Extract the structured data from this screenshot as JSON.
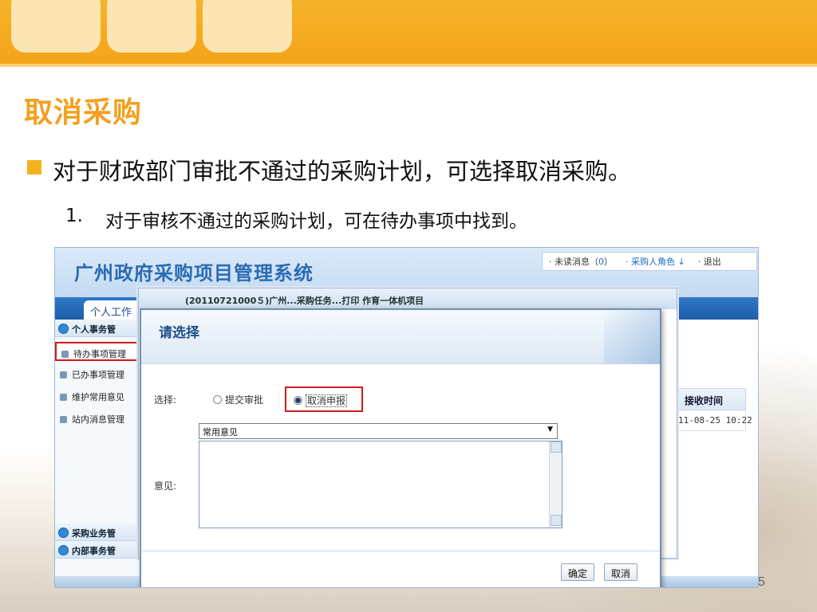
{
  "slide": {
    "title": "取消采购",
    "bullet": "对于财政部门审批不通过的采购计划，可选择取消采购。",
    "sub_number": "1.",
    "sub_text": "对于审核不通过的采购计划，可在待办事项中找到。",
    "page_number": "5",
    "accent_color": "#f3a01f"
  },
  "app": {
    "title": "广州政府采购项目管理系统",
    "top_links": {
      "unread_prefix": "· 未读消息（",
      "unread_count": "0",
      "unread_suffix": "）",
      "role": "· 采购人角色 ↓",
      "logout": "· 退出"
    },
    "nav_tab": "个人工作",
    "sidebar": {
      "group1": "个人事务管",
      "items": [
        "待办事项管理",
        "已办事项管理",
        "维护常用意见",
        "站内消息管理"
      ],
      "group2": "采购业务管",
      "group3": "内部事务管"
    },
    "table": {
      "header": "接收时间",
      "cell": "11-08-25 10:22"
    },
    "bg_window_title": "(20110721000５)广州...采购任务...打印 作育一体机项目"
  },
  "dialog": {
    "title": "请选择",
    "select_label": "选择:",
    "option_submit": "提交审批",
    "option_cancel": "取消申报",
    "opinion_select": "常用意见",
    "opinion_label": "意见:",
    "ok": "确定",
    "cancel": "取消"
  }
}
